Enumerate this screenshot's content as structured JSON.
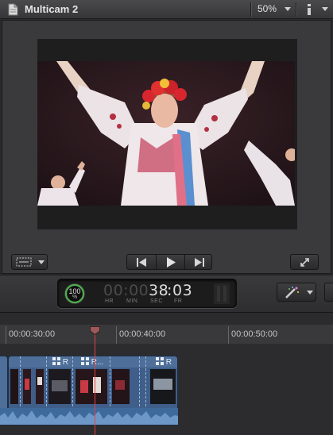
{
  "viewer": {
    "title": "Multicam 2",
    "zoom": "50%"
  },
  "icons": {
    "document": "document-icon",
    "view_options": "view-options-icon",
    "view_mode": "view-mode-icon",
    "go_to_start": "go-to-start-icon",
    "play": "play-icon",
    "go_to_end": "go-to-end-icon",
    "fullscreen": "fullscreen-icon",
    "effects": "magic-wand-icon"
  },
  "dashboard": {
    "progress": "100",
    "progress_unit": "%",
    "progress_fraction": 1.0,
    "timecode_dim": "00:00:",
    "timecode_seconds": "38",
    "timecode_frames_sep": ":",
    "timecode_frames": "03",
    "units": {
      "hr": "HR",
      "min": "MIN",
      "sec": "SEC",
      "fr": "FR"
    }
  },
  "timeline": {
    "ruler_labels": [
      "00:00:30:00",
      "00:00:40:00",
      "00:00:50:00"
    ],
    "clips": [
      {
        "label": "R"
      },
      {
        "label": "R..."
      },
      {
        "label": "R"
      }
    ]
  },
  "colors": {
    "clip": "#4e6f99",
    "playhead": "#e04444",
    "progress_ring": "#4fb04f"
  }
}
